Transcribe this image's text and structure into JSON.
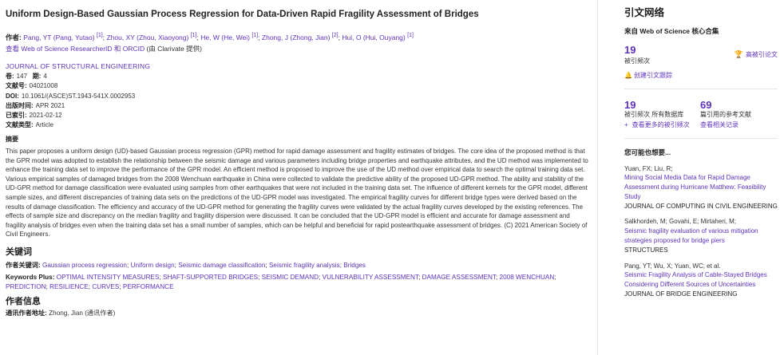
{
  "record": {
    "title": "Uniform Design-Based Gaussian Process Regression for Data-Driven Rapid Fragility Assessment of Bridges",
    "authors_label": "作者:",
    "authors": [
      {
        "short": "Pang, YT",
        "full": "(Pang, Yutao)",
        "ref": "[1]"
      },
      {
        "short": "Zhou, XY",
        "full": "(Zhou, Xiaoyong)",
        "ref": "[1]"
      },
      {
        "short": "He, W",
        "full": "(He, Wei)",
        "ref": "[1]"
      },
      {
        "short": "Zhong, J",
        "full": "(Zhong, Jian)",
        "ref": "[2]"
      },
      {
        "short": "Hui, O",
        "full": "(Hui, Ouyang)",
        "ref": "[1]"
      }
    ],
    "rid_link": "查看 Web of Science ResearcherID 和 ORCID",
    "rid_provided": "(由 Clarivate 提供)",
    "journal": "JOURNAL OF STRUCTURAL ENGINEERING",
    "volume_label": "卷:",
    "volume": "147",
    "issue_label": "期:",
    "issue": "4",
    "article_no_label": "文献号:",
    "article_no": "04021008",
    "doi_label": "DOI:",
    "doi": "10.1061/(ASCE)ST.1943-541X.0002953",
    "pub_date_label": "出版时间:",
    "pub_date": "APR 2021",
    "indexed_label": "已索引:",
    "indexed": "2021-02-12",
    "doc_type_label": "文献类型:",
    "doc_type": "Article",
    "abstract_label": "摘要",
    "abstract": "This paper proposes a uniform design (UD)-based Gaussian process regression (GPR) method for rapid damage assessment and fragility estimates of bridges. The core idea of the proposed method is that the GPR model was adopted to establish the relationship between the seismic damage and various parameters including bridge properties and earthquake attributes, and the UD method was implemented to enhance the training data set to improve the performance of the GPR model. An efficient method is proposed to improve the use of the UD method over empirical data to search the optimal training data set. Various empirical samples of damaged bridges from the 2008 Wenchuan earthquake in China were collected to validate the predictive ability of the proposed UD-GPR method. The ability and stability of the UD-GPR method for damage classification were evaluated using samples from other earthquakes that were not included in the training data set. The influence of different kernels for the GPR model, different sample sizes, and different discrepancies of training data sets on the predictions of the UD-GPR model was investigated. The empirical fragility curves for different bridge types were derived based on the results of damage classification. The efficiency and accuracy of the UD-GPR method for generating the fragility curves were validated by the actual fragility curves developed by the existing references. The effects of sample size and discrepancy on the median fragility and fragility dispersion were discussed. It can be concluded that the UD-GPR model is efficient and accurate for damage assessment and fragility analysis of bridges even when the training data set has a small number of samples, which can be helpful and beneficial for rapid postearthquake assessment of bridges. (C) 2021 American Society of Civil Engineers.",
    "keywords_heading": "关键词",
    "author_kw_label": "作者关键词:",
    "author_keywords": [
      "Gaussian process regression",
      "Uniform design",
      "Seismic damage classification",
      "Seismic fragility analysis",
      "Bridges"
    ],
    "kwplus_label": "Keywords Plus:",
    "keywords_plus": [
      "OPTIMAL INTENSITY MEASURES",
      "SHAFT-SUPPORTED BRIDGES",
      "SEISMIC DEMAND",
      "VULNERABILITY ASSESSMENT",
      "DAMAGE ASSESSMENT",
      "2008 WENCHUAN",
      "PREDICTION",
      "RESILIENCE",
      "CURVES",
      "PERFORMANCE"
    ],
    "author_info_heading": "作者信息",
    "corr_label": "通讯作者地址:",
    "corr_value": "Zhong, Jian (通讯作者)"
  },
  "citation_network": {
    "title": "引文网络",
    "source": "来自 Web of Science 核心合集",
    "times_cited": "19",
    "times_cited_label": "被引频次",
    "highly_cited": "高被引论文",
    "create_alert": "创建引文跟踪",
    "all_db_count": "19",
    "all_db_label": "被引频次 所有数据库",
    "refs_count": "69",
    "refs_label": "篇引用的参考文献",
    "see_more_times_cited": "查看更多的被引频次",
    "see_related": "查看相关记录",
    "may_like_heading": "您可能也想要...",
    "recommendations": [
      {
        "authors": "Yuan, FX; Liu, R;",
        "title": "Mining Social Media Data for Rapid Damage Assessment during Hurricane Matthew: Feasibility Study",
        "journal": "JOURNAL OF COMPUTING IN CIVIL ENGINEERING"
      },
      {
        "authors": "Salkhordeh, M; Govahi, E; Mirtaheri, M;",
        "title": "Seismic fragility evaluation of various mitigation strategies proposed for bridge piers",
        "journal": "STRUCTURES"
      },
      {
        "authors": "Pang, YT; Wu, X; Yuan, WC; et al.",
        "title": "Seismic Fragility Analysis of Cable-Stayed Bridges Considering Different Sources of Uncertainties",
        "journal": "JOURNAL OF BRIDGE ENGINEERING"
      }
    ]
  },
  "colors": {
    "link": "#5e33bf",
    "text": "#333333",
    "trophy": "#e07b00"
  },
  "icons": [
    "trophy-icon",
    "bell-icon",
    "plus-icon"
  ]
}
